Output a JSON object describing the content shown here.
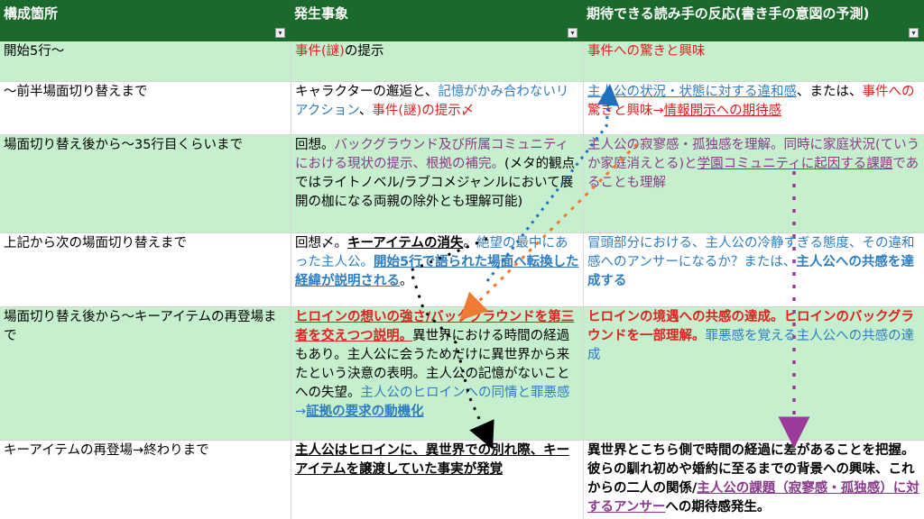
{
  "header": {
    "col1": "構成箇所",
    "col2": "発生事象",
    "col3": "期待できる読み手の反応(書き手の意図の予測)",
    "filter_glyph": "▾"
  },
  "rows": [
    {
      "c1": "開始5行〜",
      "c2": [
        {
          "t": "事件(謎)",
          "cls": "red"
        },
        {
          "t": "の提示",
          "cls": ""
        }
      ],
      "c3": [
        {
          "t": "事件への驚きと興味",
          "cls": "red"
        }
      ]
    },
    {
      "c1": "〜前半場面切り替えまで",
      "c2": [
        {
          "t": "キャラクターの邂逅と、",
          "cls": ""
        },
        {
          "t": "記憶がかみ合わないリアクション",
          "cls": "blue"
        },
        {
          "t": "、",
          "cls": ""
        },
        {
          "t": "事件(謎)の提示〆",
          "cls": "red"
        }
      ],
      "c3": [
        {
          "t": "主人公の状況・状態に対する違和感",
          "cls": "blue u"
        },
        {
          "t": "、または、",
          "cls": ""
        },
        {
          "t": "事件への驚きと興味→",
          "cls": "red"
        },
        {
          "t": "情報開示への期待感",
          "cls": "red u"
        }
      ]
    },
    {
      "c1": "場面切り替え後から〜35行目くらいまで",
      "c2": [
        {
          "t": "回想。",
          "cls": ""
        },
        {
          "t": "バックグラウンド及び所属コミュニティにおける現状の提示、根拠の補完。",
          "cls": "purple"
        },
        {
          "t": "(メタ的観点ではライトノベル/ラブコメジャンルにおいて展開の枷になる両親の除外とも理解可能)",
          "cls": ""
        }
      ],
      "c3": [
        {
          "t": "主人公の寂寥感・孤独感を理解。同時に家庭状況(ていうか家庭消えとる)と",
          "cls": "purple"
        },
        {
          "t": "学園コミュニティに起因する課題",
          "cls": "purple u"
        },
        {
          "t": "であることも理解",
          "cls": "purple"
        }
      ]
    },
    {
      "c1": "上記から次の場面切り替えまで",
      "c2": [
        {
          "t": "回想〆。",
          "cls": ""
        },
        {
          "t": "キーアイテムの消失",
          "cls": "b u"
        },
        {
          "t": "。",
          "cls": ""
        },
        {
          "t": "絶望の最中にあった主人公。",
          "cls": "blue"
        },
        {
          "t": "開始5行で語られた場面へ転換した経緯が説明される",
          "cls": "blue b u"
        },
        {
          "t": "。",
          "cls": ""
        }
      ],
      "c3": [
        {
          "t": "冒頭部分における、主人公の冷静すぎる態度、その違和感へのアンサーになるか？または、",
          "cls": "blue"
        },
        {
          "t": "主人公への共感を達成する",
          "cls": "blue b"
        }
      ]
    },
    {
      "c1": "場面切り替え後から〜キーアイテムの再登場まで",
      "c2": [
        {
          "t": "ヒロインの想いの強さ/バックグラウンドを第三者を交えつつ説明。",
          "cls": "red b u"
        },
        {
          "t": "異世界における時間の経過もあり。主人公に会うためだけに異世界から来たという決意の表明。主人公の記憶がないことへの失望。",
          "cls": ""
        },
        {
          "t": "主人公のヒロインへの同情と罪悪感→",
          "cls": "blue"
        },
        {
          "t": "証拠の要求の動機化",
          "cls": "blue b u"
        }
      ],
      "c3": [
        {
          "t": "ヒロインの境遇への共感の達成。ヒロインのバックグラウンドを一部理解。",
          "cls": "red b"
        },
        {
          "t": "罪悪感を覚える主人公への共感の達成",
          "cls": "blue"
        }
      ]
    },
    {
      "c1": "キーアイテムの再登場→終わりまで",
      "c2": [
        {
          "t": "主人公はヒロインに、異世界での別れ際、キーアイテムを譲渡していた事実が発覚",
          "cls": "b u"
        }
      ],
      "c3": [
        {
          "t": "異世界とこちら側で時間の経過に差があることを把握。彼らの馴れ初めや婚約に至るまでの背景への興味、これからの二人の関係/",
          "cls": "b"
        },
        {
          "t": "主人公の課題（寂寥感・孤独感）に対するアンサー",
          "cls": "purple b u"
        },
        {
          "t": "への期待感発生。",
          "cls": "b"
        }
      ]
    }
  ],
  "annotations": {
    "colors": {
      "blue": "#1f6fc0",
      "orange": "#ee7a33",
      "purple": "#9b3a9b",
      "black": "#000000"
    }
  }
}
